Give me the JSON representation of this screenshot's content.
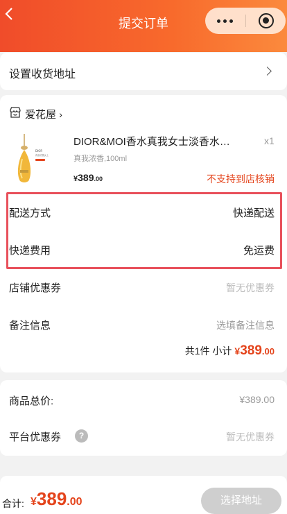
{
  "header": {
    "title": "提交订单"
  },
  "address": {
    "label": "设置收货地址"
  },
  "shop": {
    "name": "爱花屋"
  },
  "product": {
    "title": "DIOR&MOI香水真我女士淡香水持久",
    "spec": "真我浓香,100ml",
    "qty": "x1",
    "price_currency": "¥",
    "price_int": "389",
    "price_dec": ".00",
    "store_note": "不支持到店核销"
  },
  "delivery": {
    "method_label": "配送方式",
    "method_value": "快递配送",
    "fee_label": "快递费用",
    "fee_value": "免运费"
  },
  "coupon": {
    "label": "店铺优惠券",
    "value": "暂无优惠券"
  },
  "remark": {
    "label": "备注信息",
    "placeholder": "选填备注信息"
  },
  "subtotal": {
    "text": "共1件 小计",
    "currency": "¥",
    "int": "389",
    "dec": ".00"
  },
  "totals": {
    "goods_label": "商品总价:",
    "goods_value": "¥389.00",
    "platform_coupon_label": "平台优惠券",
    "platform_coupon_value": "暂无优惠券"
  },
  "footer": {
    "total_label": "合计:",
    "currency": "¥",
    "int": "389",
    "dec": ".00",
    "button_label": "选择地址"
  },
  "colors": {
    "accent": "#e4441c",
    "header_start": "#f04c2a",
    "header_end": "#fb8a3d",
    "highlight": "#e8505b"
  }
}
